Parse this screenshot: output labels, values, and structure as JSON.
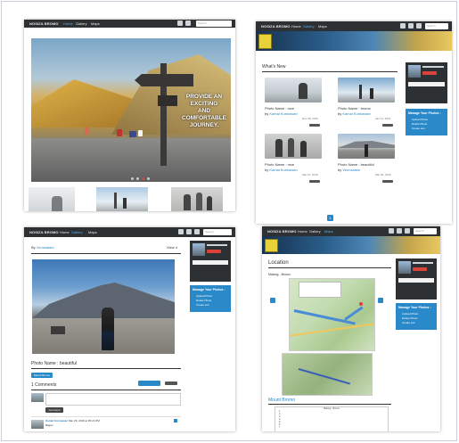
{
  "brand": "NOSIZA BROMO",
  "nav": {
    "home": "Home",
    "gallery": "Gallery",
    "maps": "Maps",
    "search_placeholder": "Search"
  },
  "slide1": {
    "caption_lines": [
      "PROVIDE AN",
      "EXCITING",
      "AND",
      "COMFORTABLE",
      "JOURNEY."
    ],
    "dots": 4
  },
  "slide2": {
    "title": "What's New",
    "cards": [
      {
        "name": "Photo Name : mce",
        "by": "by",
        "author": "Kamal Kurniawan",
        "date": "Dec 28, 2015"
      },
      {
        "name": "Photo Name : bromo",
        "by": "by",
        "author": "Kamal Kurniawan",
        "date": "Jan 01, 2016"
      },
      {
        "name": "Photo Name : mce",
        "by": "by",
        "author": "Kamal Kurniawan",
        "date": "Mar 07, 2016"
      },
      {
        "name": "Photo Name : beautiful",
        "by": "by",
        "author": "Venusalam",
        "date": "Mar 06, 2016"
      }
    ],
    "page": "1",
    "manage_title": "Manage Your Photos :",
    "manage_items": [
      "Upload Photo",
      "Delete Photo",
      "Create List"
    ]
  },
  "slide3": {
    "by_label": "By",
    "author": "Venusalam",
    "view": "View 4",
    "photo_name": "Photo Name : beautiful",
    "tag": "Mount Bromo",
    "comments": "1 Comments",
    "comment_author": "Kamal Kurniawan",
    "comment_text": "Mar 26, 2016 at 05:21 PM",
    "comment_body": "Bagus",
    "submit": "Comment"
  },
  "slide4": {
    "title": "Location",
    "subtitle": "Malang - Bromo",
    "list_title": "Mount Bromo",
    "table_header": "Malang - Bromo",
    "rows": [
      "1",
      "2",
      "3",
      "4",
      "5",
      "6",
      "7",
      "8",
      "9",
      "10"
    ]
  },
  "colors": {
    "accent": "#2a89c8",
    "nav": "#2d3133",
    "danger": "#d9433a"
  }
}
